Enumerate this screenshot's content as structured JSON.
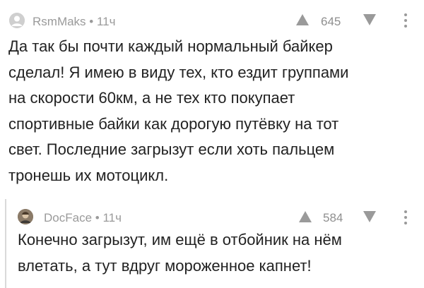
{
  "comments": [
    {
      "author": "RsmMaks",
      "time": "11ч",
      "rating": "645",
      "lines": [
        "Да так бы почти каждый нормальный байкер",
        "сделал! Я имею в виду тех, кто ездит группами",
        "на скорости 60км, а не тех кто покупает",
        "спортивные байки как дорогую путёвку на тот",
        "свет. Последние загрызут если хоть пальцем",
        "тронешь их мотоцикл."
      ]
    },
    {
      "author": "DocFace",
      "time": "11ч",
      "rating": "584",
      "lines": [
        "Конечно загрызут, им ещё в отбойник на нём",
        "влетать, а тут вдруг мороженное капнет!"
      ]
    }
  ],
  "separator": " • ",
  "icons": {
    "upvote": "triangle-up-icon",
    "downvote": "triangle-down-icon",
    "more": "more-vertical-icon",
    "avatar_main": "default-avatar-icon",
    "avatar_reply": "user-avatar-icon"
  },
  "colors": {
    "meta_text": "#9a9a9a",
    "body_text": "#222222",
    "rail": "#d9d9d9"
  }
}
